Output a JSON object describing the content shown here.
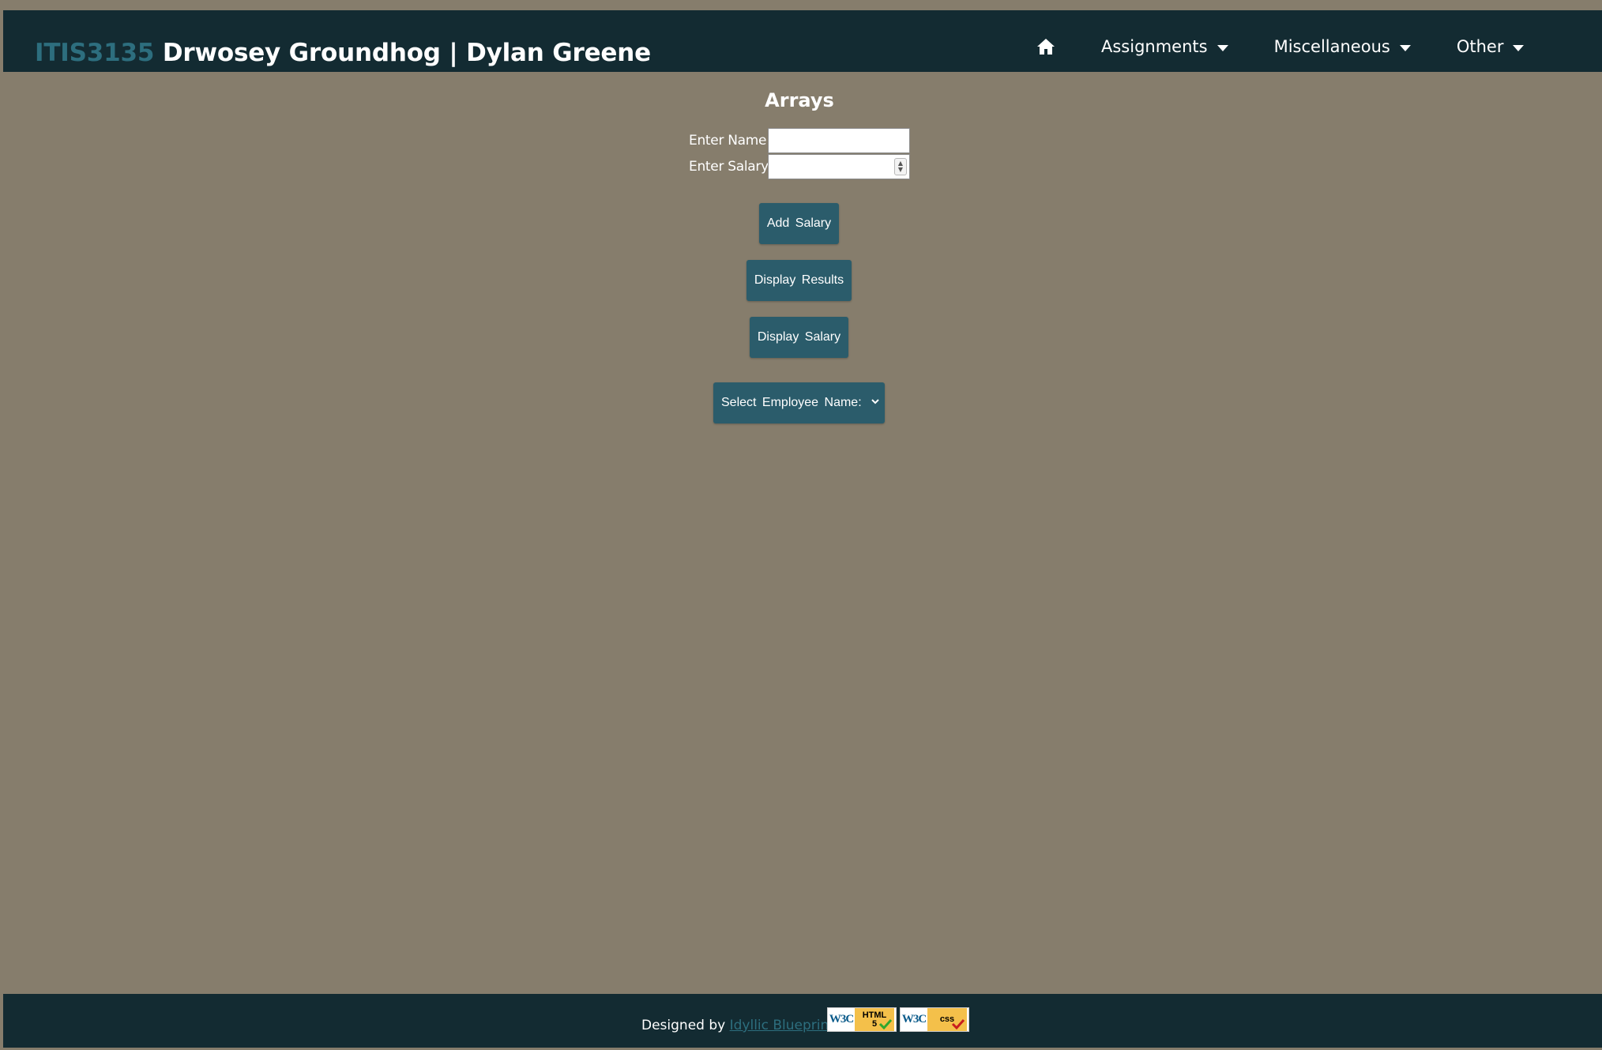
{
  "header": {
    "course_code": "ITIS3135",
    "site_title": "Drwosey Groundhog | Dylan Greene"
  },
  "nav": {
    "home_icon": "home-icon",
    "items": [
      {
        "label": "Assignments"
      },
      {
        "label": "Miscellaneous"
      },
      {
        "label": "Other"
      }
    ]
  },
  "main": {
    "title": "Arrays",
    "name_label": "Enter Name:",
    "name_value": "",
    "salary_label": "Enter Salary:",
    "salary_value": "",
    "add_salary_label": "Add Salary",
    "display_results_label": "Display Results",
    "display_salary_label": "Display Salary",
    "employee_select_label": "Select Employee Name:"
  },
  "footer": {
    "designed_by_label": "Designed by",
    "designer_link": "Idyllic Blueprint",
    "html_badge": {
      "org": "W3C",
      "kind_top": "HTML",
      "kind_bottom": "5"
    },
    "css_badge": {
      "org": "W3C",
      "kind_top": "css"
    }
  },
  "colors": {
    "background": "#867d6c",
    "bar": "#132b32",
    "accent": "#2d6e7e",
    "button": "#2b5c6b"
  }
}
